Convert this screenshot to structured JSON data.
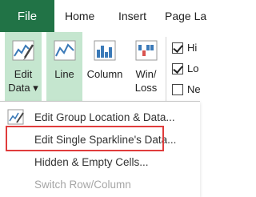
{
  "tabs": {
    "file": "File",
    "home": "Home",
    "insert": "Insert",
    "page_layout": "Page La"
  },
  "ribbon": {
    "edit_data": {
      "line1": "Edit",
      "line2": "Data",
      "arrow": "▾"
    },
    "line": {
      "label": "Line"
    },
    "column": {
      "label": "Column"
    },
    "win_loss": {
      "line1": "Win/",
      "line2": "Loss"
    },
    "checkboxes": [
      {
        "label": "Hi",
        "checked": true
      },
      {
        "label": "Lo",
        "checked": true
      },
      {
        "label": "Ne",
        "checked": false
      }
    ]
  },
  "menu": {
    "items": [
      {
        "label": "Edit Group Location & Data...",
        "icon": "sparkline-edit-icon",
        "enabled": true
      },
      {
        "label": "Edit Single Sparkline's Data...",
        "icon": "",
        "enabled": true
      },
      {
        "label": "Hidden & Empty Cells...",
        "icon": "",
        "enabled": true
      },
      {
        "label": "Switch Row/Column",
        "icon": "",
        "enabled": false
      }
    ]
  },
  "colors": {
    "file_tab": "#217346",
    "active_button": "#c5e6cf",
    "highlight_box": "#e03c3c"
  }
}
